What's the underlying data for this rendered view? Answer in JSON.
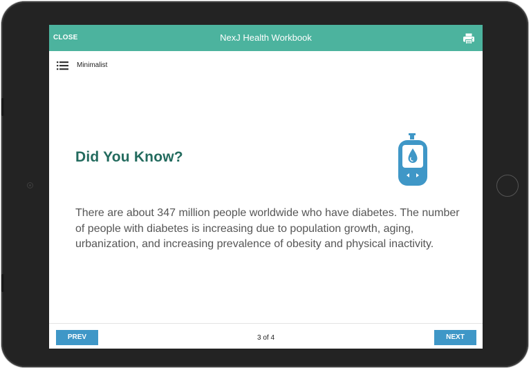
{
  "header": {
    "close_label": "CLOSE",
    "title": "NexJ Health Workbook",
    "print_icon": "print-icon"
  },
  "toolbar": {
    "menu_icon": "list-menu-icon",
    "theme_label": "Minimalist"
  },
  "content": {
    "title": "Did You Know?",
    "body": "There are about 347 million people worldwide who have diabetes. The number of people with diabetes is increasing due to population growth, aging, urbanization, and increasing prevalence of obesity and physical inactivity.",
    "illustration_icon": "glucose-meter-icon"
  },
  "footer": {
    "prev_label": "PREV",
    "page_indicator": "3 of 4",
    "next_label": "NEXT"
  },
  "colors": {
    "header_bg": "#4cb39e",
    "title_text": "#236b5e",
    "button_bg": "#3f97c7",
    "icon_blue": "#3f97c7"
  }
}
